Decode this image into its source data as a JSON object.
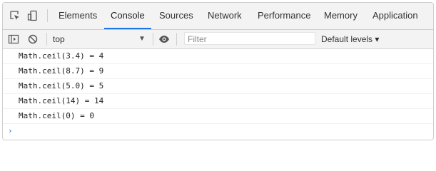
{
  "tabs": [
    {
      "label": "Elements"
    },
    {
      "label": "Console"
    },
    {
      "label": "Sources"
    },
    {
      "label": "Network"
    },
    {
      "label": "Performance"
    },
    {
      "label": "Memory"
    },
    {
      "label": "Application"
    }
  ],
  "active_tab": "Console",
  "toolbar": {
    "context": "top",
    "filter_placeholder": "Filter",
    "levels": "Default levels ▾"
  },
  "console": {
    "lines": [
      "Math.ceil(3.4) = 4",
      "Math.ceil(8.7) = 9",
      "Math.ceil(5.0) = 5",
      "Math.ceil(14) = 14",
      "Math.ceil(0) = 0"
    ],
    "prompt": "›"
  },
  "colors": {
    "accent": "#1a73e8",
    "toolbar_bg": "#f3f3f3"
  }
}
